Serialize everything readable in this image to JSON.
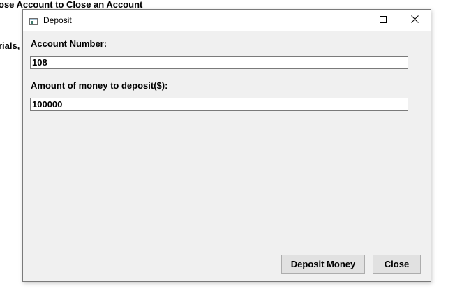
{
  "background": {
    "line1": "ose Account to Close an Account",
    "line2": "rials,"
  },
  "window": {
    "title": "Deposit",
    "icons": {
      "app": "app-window-icon",
      "minimize": "minimize-icon",
      "maximize": "maximize-icon",
      "close": "close-icon"
    }
  },
  "form": {
    "account_label": "Account Number:",
    "account_value": "108",
    "amount_label": "Amount of money to deposit($):",
    "amount_value": "100000"
  },
  "buttons": {
    "deposit_label": "Deposit Money",
    "close_label": "Close"
  },
  "colors": {
    "window_bg": "#f0f0f0",
    "titlebar_bg": "#ffffff",
    "button_bg": "#e1e1e1",
    "border": "#7a7a7a"
  }
}
